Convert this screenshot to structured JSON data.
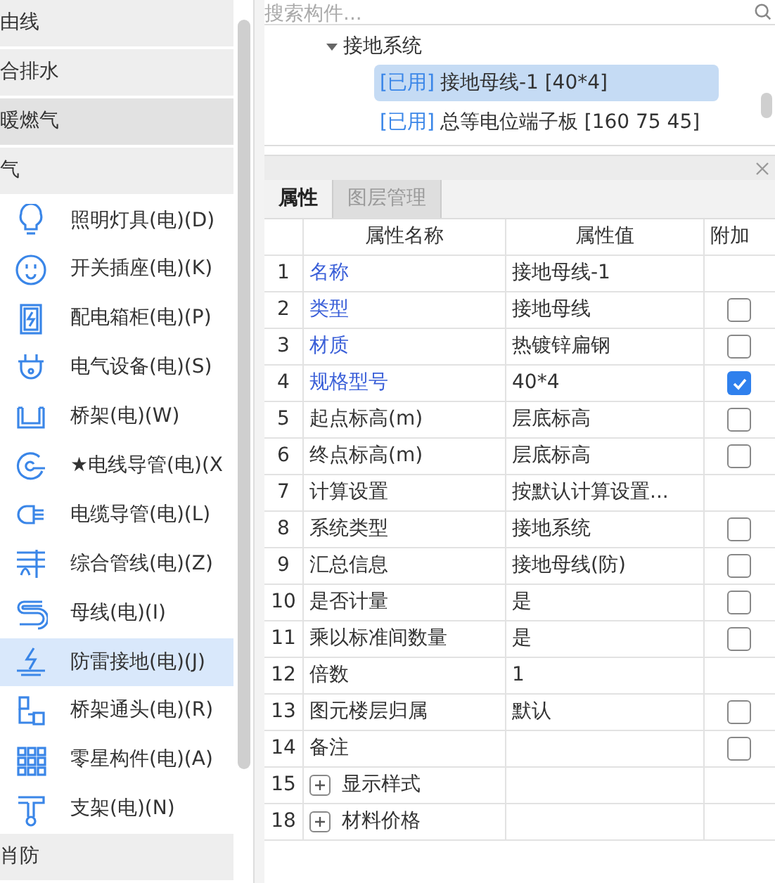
{
  "sidebar": {
    "groups_top": [
      {
        "label": "由线",
        "hover": false
      },
      {
        "label": "合排水",
        "hover": false
      },
      {
        "label": "暖燃气",
        "hover": true
      },
      {
        "label": "气",
        "hover": false
      }
    ],
    "items": [
      {
        "label": "照明灯具(电)(D)",
        "selected": false
      },
      {
        "label": "开关插座(电)(K)",
        "selected": false
      },
      {
        "label": "配电箱柜(电)(P)",
        "selected": false
      },
      {
        "label": "电气设备(电)(S)",
        "selected": false
      },
      {
        "label": "桥架(电)(W)",
        "selected": false
      },
      {
        "label": "★电线导管(电)(X",
        "selected": false
      },
      {
        "label": "电缆导管(电)(L)",
        "selected": false
      },
      {
        "label": "综合管线(电)(Z)",
        "selected": false
      },
      {
        "label": "母线(电)(I)",
        "selected": false
      },
      {
        "label": "防雷接地(电)(J)",
        "selected": true
      },
      {
        "label": "桥架通头(电)(R)",
        "selected": false
      },
      {
        "label": "零星构件(电)(A)",
        "selected": false
      },
      {
        "label": "支架(电)(N)",
        "selected": false
      }
    ],
    "groups_bottom": [
      {
        "label": "肖防",
        "hover": false
      }
    ]
  },
  "search": {
    "placeholder": "搜索构件..."
  },
  "tree": {
    "label": "接地系统",
    "expanded": true,
    "children": [
      {
        "tag": "[已用]",
        "label": "接地母线-1 [40*4]",
        "selected": true
      },
      {
        "tag": "[已用]",
        "label": "总等电位端子板 [160 75 45]",
        "selected": false
      }
    ]
  },
  "tabs": [
    {
      "label": "属性",
      "selected": true
    },
    {
      "label": "图层管理",
      "selected": false
    }
  ],
  "table": {
    "columns": [
      "属性名称",
      "属性值",
      "附加"
    ],
    "rows": [
      {
        "num": "1",
        "name": "名称",
        "value": "接地母线-1",
        "highlighted": true,
        "kind": "plain"
      },
      {
        "num": "2",
        "name": "类型",
        "value": "接地母线",
        "highlighted": true,
        "kind": "checkbox",
        "checked": false
      },
      {
        "num": "3",
        "name": "材质",
        "value": "热镀锌扁钢",
        "highlighted": true,
        "kind": "checkbox",
        "checked": false
      },
      {
        "num": "4",
        "name": "规格型号",
        "value": "40*4",
        "highlighted": true,
        "kind": "checkbox",
        "checked": true
      },
      {
        "num": "5",
        "name": "起点标高(m)",
        "value": "层底标高",
        "highlighted": false,
        "kind": "checkbox",
        "checked": false
      },
      {
        "num": "6",
        "name": "终点标高(m)",
        "value": "层底标高",
        "highlighted": false,
        "kind": "checkbox",
        "checked": false
      },
      {
        "num": "7",
        "name": "计算设置",
        "value": "按默认计算设置...",
        "highlighted": false,
        "kind": "plain"
      },
      {
        "num": "8",
        "name": "系统类型",
        "value": "接地系统",
        "highlighted": false,
        "kind": "checkbox",
        "checked": false
      },
      {
        "num": "9",
        "name": "汇总信息",
        "value": "接地母线(防)",
        "highlighted": false,
        "kind": "checkbox",
        "checked": false
      },
      {
        "num": "10",
        "name": "是否计量",
        "value": "是",
        "highlighted": false,
        "kind": "checkbox",
        "checked": false
      },
      {
        "num": "11",
        "name": "乘以标准间数量",
        "value": "是",
        "highlighted": false,
        "kind": "checkbox",
        "checked": false
      },
      {
        "num": "12",
        "name": "倍数",
        "value": "1",
        "highlighted": false,
        "kind": "plain"
      },
      {
        "num": "13",
        "name": "图元楼层归属",
        "value": "默认",
        "highlighted": false,
        "kind": "checkbox",
        "checked": false
      },
      {
        "num": "14",
        "name": "备注",
        "highlighted": false,
        "kind": "checkbox",
        "checked": false
      },
      {
        "num": "15",
        "name": "显示样式",
        "highlighted": false,
        "kind": "group",
        "expanded": false
      },
      {
        "num": "18",
        "name": "材料价格",
        "highlighted": false,
        "kind": "group",
        "expanded": false
      }
    ]
  }
}
